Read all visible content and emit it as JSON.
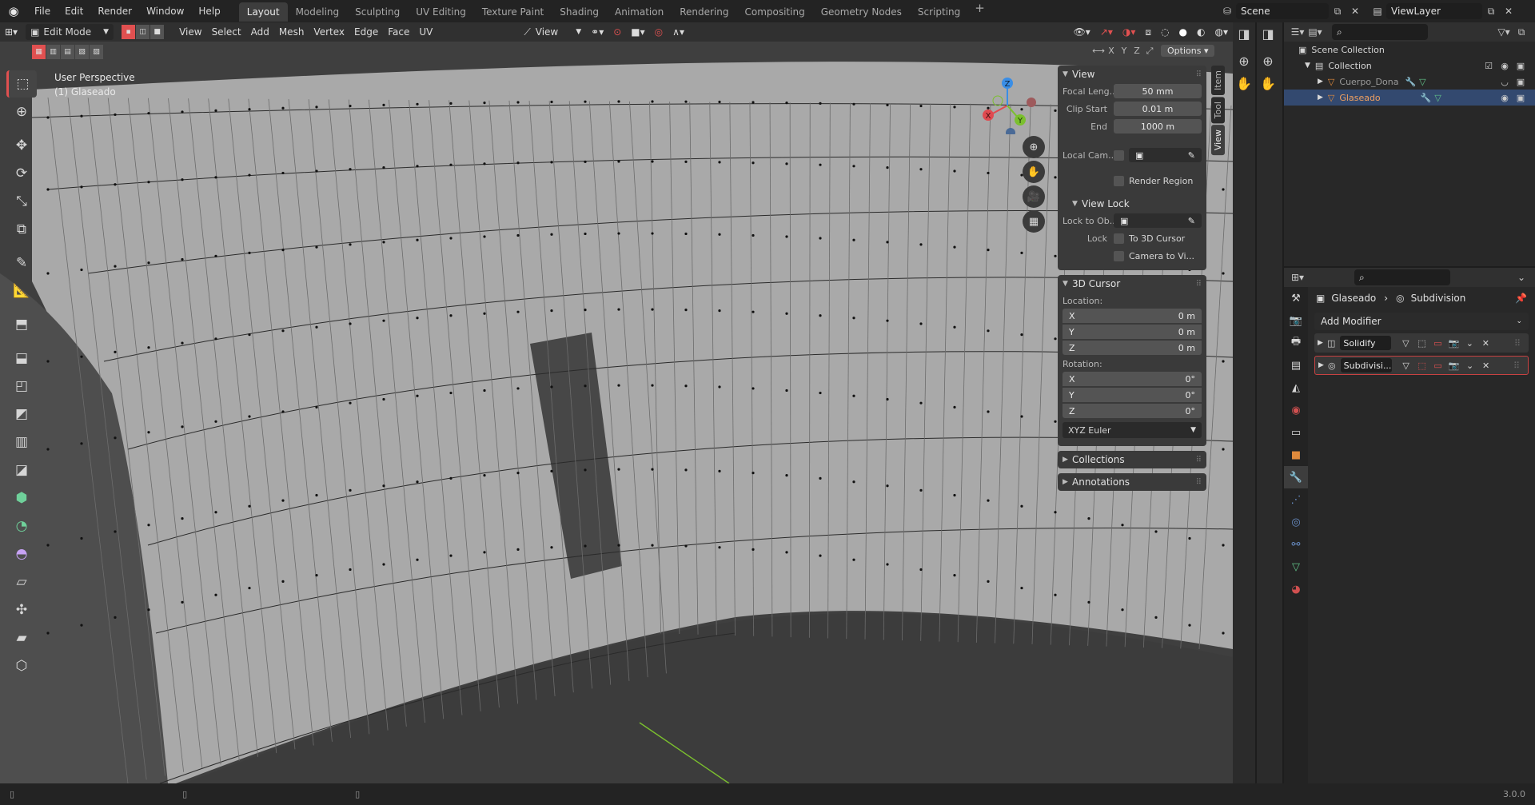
{
  "topbar": {
    "menus": [
      "File",
      "Edit",
      "Render",
      "Window",
      "Help"
    ],
    "workspaces": [
      "Layout",
      "Modeling",
      "Sculpting",
      "UV Editing",
      "Texture Paint",
      "Shading",
      "Animation",
      "Rendering",
      "Compositing",
      "Geometry Nodes",
      "Scripting"
    ],
    "active_workspace": "Layout",
    "add_workspace": "+",
    "scene": "Scene",
    "view_layer": "ViewLayer"
  },
  "viewport_header": {
    "mode": "Edit Mode",
    "menus": [
      "View",
      "Select",
      "Add",
      "Mesh",
      "Vertex",
      "Edge",
      "Face",
      "UV"
    ],
    "transform_orientation": "View",
    "axes": [
      "X",
      "Y",
      "Z"
    ],
    "options": "Options"
  },
  "viewport": {
    "perspective": "User Perspective",
    "object": "(1) Glaseado"
  },
  "toolbar": {
    "tools": [
      "select-box",
      "cursor",
      "move",
      "rotate",
      "scale",
      "transform",
      "annotate",
      "measure",
      "add-cube",
      "extrude",
      "inset",
      "bevel",
      "loop-cut",
      "knife",
      "poly-build",
      "spin",
      "smooth",
      "edge-slide",
      "shrink-fatten",
      "shear",
      "rip"
    ]
  },
  "gizmo": {
    "x": "X",
    "y": "Y",
    "z": "Z"
  },
  "npanel": {
    "tabs": [
      "Item",
      "Tool",
      "View"
    ],
    "active_tab": "View",
    "view": {
      "title": "View",
      "focal_label": "Focal Leng...",
      "focal_value": "50 mm",
      "clip_start_label": "Clip Start",
      "clip_start_value": "0.01 m",
      "end_label": "End",
      "end_value": "1000 m",
      "local_cam_label": "Local Cam...",
      "render_region": "Render Region"
    },
    "view_lock": {
      "title": "View Lock",
      "lock_obj_label": "Lock to Ob...",
      "lock_label": "Lock",
      "to_cursor": "To 3D Cursor",
      "camera_to_view": "Camera to Vi..."
    },
    "cursor": {
      "title": "3D Cursor",
      "location_label": "Location:",
      "loc_x": "0 m",
      "loc_y": "0 m",
      "loc_z": "0 m",
      "rotation_label": "Rotation:",
      "rot_x": "0°",
      "rot_y": "0°",
      "rot_z": "0°",
      "mode": "XYZ Euler"
    },
    "collections": "Collections",
    "annotations": "Annotations"
  },
  "outliner": {
    "scene_collection": "Scene Collection",
    "collection": "Collection",
    "items": [
      {
        "name": "Cuerpo_Dona",
        "selected": false
      },
      {
        "name": "Glaseado",
        "selected": true
      }
    ]
  },
  "properties": {
    "object": "Glaseado",
    "modifier": "Subdivision",
    "add_modifier": "Add Modifier",
    "modifiers": [
      {
        "name": "Solidify",
        "active": false
      },
      {
        "name": "Subdivisi...",
        "active": true
      }
    ]
  },
  "status": {
    "version": "3.0.0"
  },
  "colors": {
    "accent_red": "#e05050",
    "selected_row": "#33496f",
    "mesh_orange": "#e08a3c",
    "axis_x": "#e04a50",
    "axis_y": "#7bc02e",
    "axis_z": "#3a8ee6"
  }
}
